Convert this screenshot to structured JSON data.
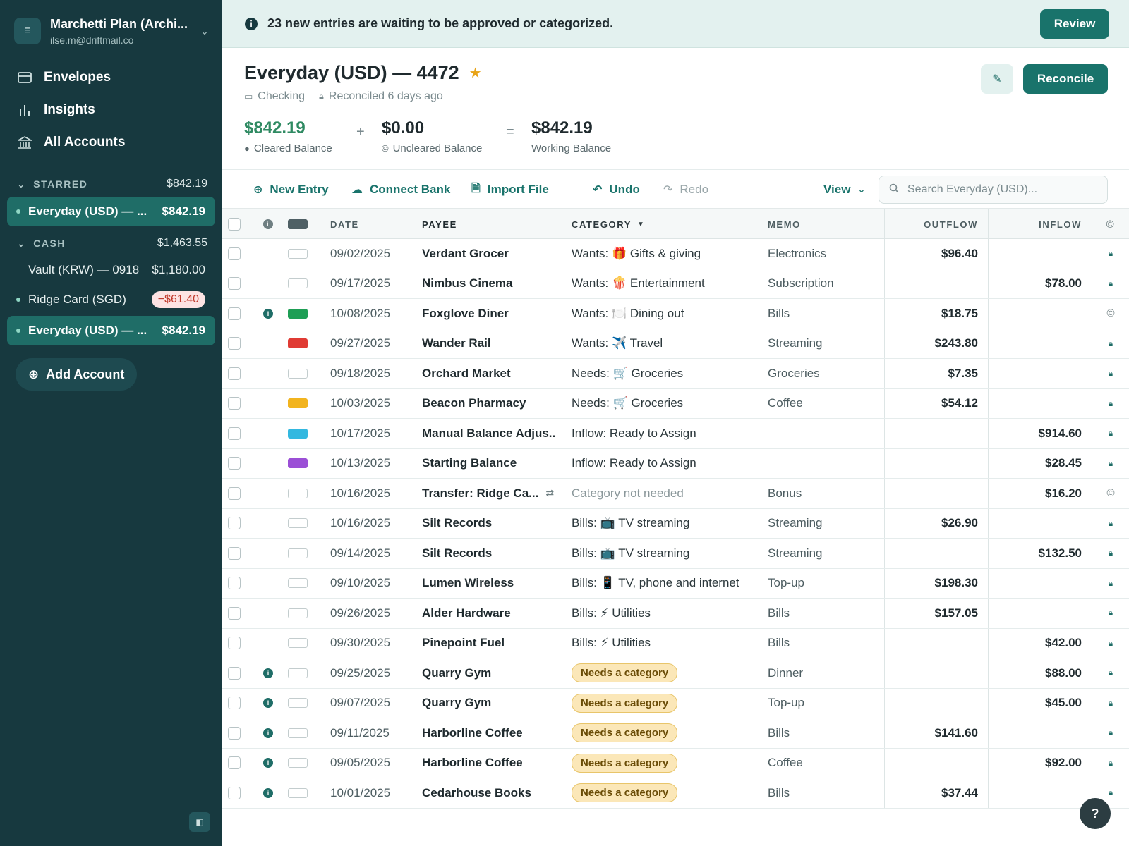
{
  "sidebar": {
    "plan_name": "Marchetti Plan (Archi...",
    "plan_email": "ilse.m@driftmail.co",
    "nav": [
      {
        "label": "Envelopes",
        "icon": "envelope-icon"
      },
      {
        "label": "Insights",
        "icon": "bar-chart-icon"
      },
      {
        "label": "All Accounts",
        "icon": "bank-icon"
      }
    ],
    "groups": [
      {
        "label": "STARRED",
        "amount": "$842.19"
      },
      {
        "label": "CASH",
        "amount": "$1,463.55"
      }
    ],
    "accounts": [
      {
        "name": "Everyday (USD) — ...",
        "balance": "$842.19"
      },
      {
        "name": "Vault (KRW) — 0918",
        "balance": "$1,180.00"
      },
      {
        "name": "Ridge Card (SGD)",
        "balance": "−$61.40"
      },
      {
        "name": "Everyday (USD) — ...",
        "balance": "$842.19"
      }
    ],
    "add_account_label": "Add Account"
  },
  "banner": {
    "message": "23 new entries are waiting to be approved or categorized.",
    "review_label": "Review"
  },
  "account": {
    "title": "Everyday (USD) — 4472",
    "type": "Checking",
    "reconciled": "Reconciled 6 days ago",
    "reconcile_label": "Reconcile",
    "cleared_value": "$842.19",
    "cleared_label": "Cleared Balance",
    "uncleared_value": "$0.00",
    "uncleared_label": "Uncleared Balance",
    "working_value": "$842.19",
    "working_label": "Working Balance",
    "plus": "+",
    "equals": "="
  },
  "toolbar": {
    "new_entry": "New Entry",
    "connect_bank": "Connect Bank",
    "import_file": "Import File",
    "undo": "Undo",
    "redo": "Redo",
    "view": "View",
    "search_placeholder": "Search Everyday (USD)..."
  },
  "table": {
    "headers": {
      "date": "DATE",
      "payee": "PAYEE",
      "category": "CATEGORY",
      "memo": "MEMO",
      "outflow": "OUTFLOW",
      "inflow": "INFLOW"
    },
    "rows": [
      {
        "info": false,
        "flag": "",
        "date": "09/02/2025",
        "payee": "Verdant Grocer",
        "category": "Wants: 🎁 Gifts & giving",
        "memo": "Electronics",
        "outflow": "$96.40",
        "inflow": "",
        "status": "locked"
      },
      {
        "info": false,
        "flag": "",
        "date": "09/17/2025",
        "payee": "Nimbus Cinema",
        "category": "Wants: 🍿 Entertainment",
        "memo": "Subscription",
        "outflow": "",
        "inflow": "$78.00",
        "status": "locked"
      },
      {
        "info": true,
        "flag": "#1e9e55",
        "date": "10/08/2025",
        "payee": "Foxglove Diner",
        "category": "Wants: 🍽️ Dining out",
        "memo": "Bills",
        "outflow": "$18.75",
        "inflow": "",
        "status": "cleared"
      },
      {
        "info": false,
        "flag": "#e03b34",
        "date": "09/27/2025",
        "payee": "Wander Rail",
        "category": "Wants: ✈️ Travel",
        "memo": "Streaming",
        "outflow": "$243.80",
        "inflow": "",
        "status": "locked"
      },
      {
        "info": false,
        "flag": "",
        "date": "09/18/2025",
        "payee": "Orchard Market",
        "category": "Needs: 🛒 Groceries",
        "memo": "Groceries",
        "outflow": "$7.35",
        "inflow": "",
        "status": "locked"
      },
      {
        "info": false,
        "flag": "#f2b41f",
        "date": "10/03/2025",
        "payee": "Beacon Pharmacy",
        "category": "Needs: 🛒 Groceries",
        "memo": "Coffee",
        "outflow": "$54.12",
        "inflow": "",
        "status": "locked"
      },
      {
        "info": false,
        "flag": "#33b8e0",
        "date": "10/17/2025",
        "payee": "Manual Balance Adjus...",
        "category": "Inflow: Ready to Assign",
        "memo": "",
        "outflow": "",
        "inflow": "$914.60",
        "status": "locked"
      },
      {
        "info": false,
        "flag": "#9b4fd6",
        "date": "10/13/2025",
        "payee": "Starting Balance",
        "category": "Inflow: Ready to Assign",
        "memo": "",
        "outflow": "",
        "inflow": "$28.45",
        "status": "locked"
      },
      {
        "info": false,
        "flag": "",
        "date": "10/16/2025",
        "payee": "Transfer: Ridge Ca...",
        "transfer": true,
        "category": "Category not needed",
        "muted": true,
        "memo": "Bonus",
        "outflow": "",
        "inflow": "$16.20",
        "status": "cleared"
      },
      {
        "info": false,
        "flag": "",
        "date": "10/16/2025",
        "payee": "Silt Records",
        "category": "Bills: 📺 TV streaming",
        "memo": "Streaming",
        "outflow": "$26.90",
        "inflow": "",
        "status": "locked"
      },
      {
        "info": false,
        "flag": "",
        "date": "09/14/2025",
        "payee": "Silt Records",
        "category": "Bills: 📺 TV streaming",
        "memo": "Streaming",
        "outflow": "",
        "inflow": "$132.50",
        "status": "locked"
      },
      {
        "info": false,
        "flag": "",
        "date": "09/10/2025",
        "payee": "Lumen Wireless",
        "category": "Bills: 📱 TV, phone and internet",
        "memo": "Top-up",
        "outflow": "$198.30",
        "inflow": "",
        "status": "locked"
      },
      {
        "info": false,
        "flag": "",
        "date": "09/26/2025",
        "payee": "Alder Hardware",
        "category": "Bills: ⚡ Utilities",
        "memo": "Bills",
        "outflow": "$157.05",
        "inflow": "",
        "status": "locked"
      },
      {
        "info": false,
        "flag": "",
        "date": "09/30/2025",
        "payee": "Pinepoint Fuel",
        "category": "Bills: ⚡ Utilities",
        "memo": "Bills",
        "outflow": "",
        "inflow": "$42.00",
        "status": "locked"
      },
      {
        "info": true,
        "flag": "",
        "date": "09/25/2025",
        "payee": "Quarry Gym",
        "category": "Needs a category",
        "needs": true,
        "memo": "Dinner",
        "outflow": "",
        "inflow": "$88.00",
        "status": "locked"
      },
      {
        "info": true,
        "flag": "",
        "date": "09/07/2025",
        "payee": "Quarry Gym",
        "category": "Needs a category",
        "needs": true,
        "memo": "Top-up",
        "outflow": "",
        "inflow": "$45.00",
        "status": "locked"
      },
      {
        "info": true,
        "flag": "",
        "date": "09/11/2025",
        "payee": "Harborline Coffee",
        "category": "Needs a category",
        "needs": true,
        "memo": "Bills",
        "outflow": "$141.60",
        "inflow": "",
        "status": "locked"
      },
      {
        "info": true,
        "flag": "",
        "date": "09/05/2025",
        "payee": "Harborline Coffee",
        "category": "Needs a category",
        "needs": true,
        "memo": "Coffee",
        "outflow": "",
        "inflow": "$92.00",
        "status": "locked"
      },
      {
        "info": true,
        "flag": "",
        "date": "10/01/2025",
        "payee": "Cedarhouse Books",
        "category": "Needs a category",
        "needs": true,
        "memo": "Bills",
        "outflow": "$37.44",
        "inflow": "",
        "status": "locked"
      }
    ]
  },
  "help_label": "?",
  "colors": {
    "sidebar": "#17393f",
    "accent": "#19736b",
    "active": "#1f6d67",
    "cleared_green": "#2f8a62"
  }
}
